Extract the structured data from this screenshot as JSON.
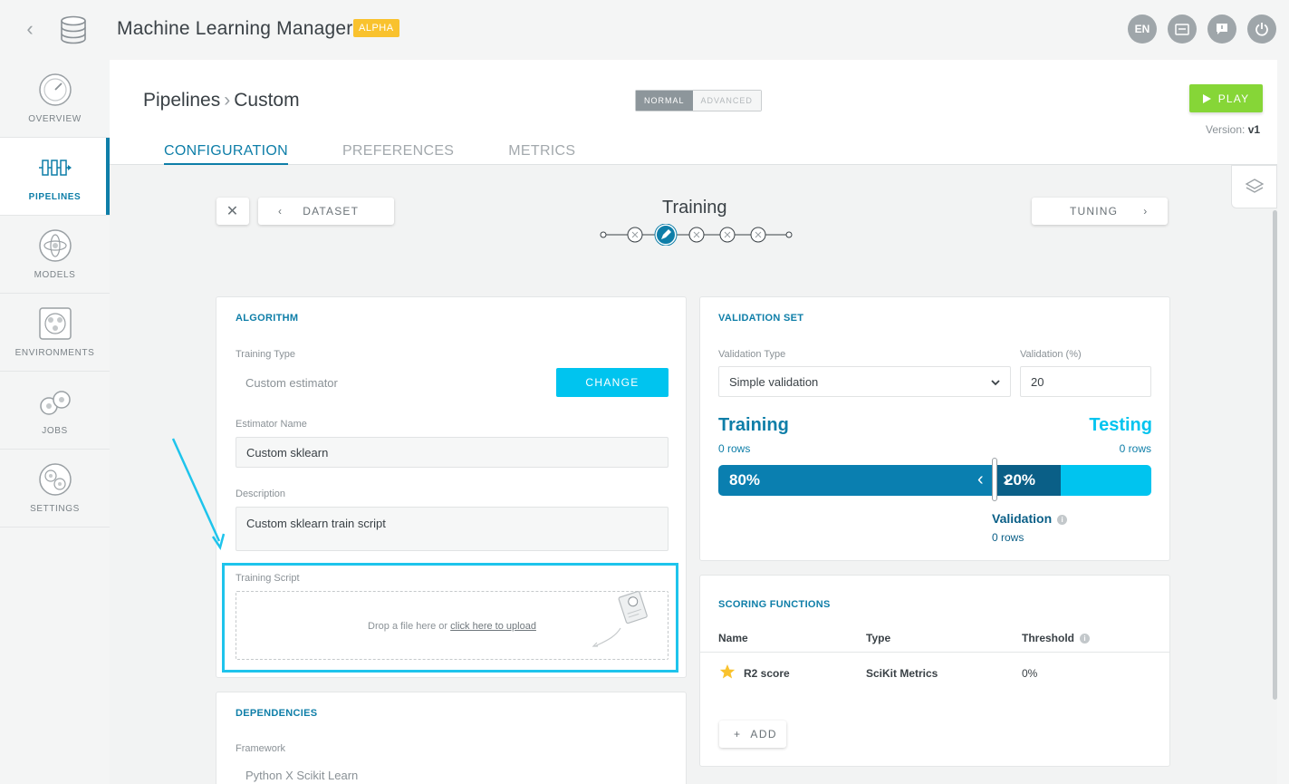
{
  "app": {
    "title": "Machine Learning Manager",
    "badge": "ALPHA",
    "top_icons": {
      "language": "EN"
    }
  },
  "sidebar": {
    "items": [
      {
        "label": "OVERVIEW",
        "icon": "gauge-icon"
      },
      {
        "label": "PIPELINES",
        "icon": "pipeline-icon",
        "active": true
      },
      {
        "label": "MODELS",
        "icon": "model-icon"
      },
      {
        "label": "ENVIRONMENTS",
        "icon": "environment-icon"
      },
      {
        "label": "JOBS",
        "icon": "jobs-icon"
      },
      {
        "label": "SETTINGS",
        "icon": "settings-icon"
      }
    ]
  },
  "header": {
    "breadcrumb": [
      "Pipelines",
      "Custom"
    ],
    "modes": [
      "NORMAL",
      "ADVANCED"
    ],
    "play_label": "PLAY",
    "version_label": "Version:",
    "version_value": "v1",
    "tabs": [
      "CONFIGURATION",
      "PREFERENCES",
      "METRICS"
    ]
  },
  "steps": {
    "prev_label": "DATASET",
    "next_label": "TUNING",
    "current_title": "Training"
  },
  "algorithm": {
    "title": "ALGORITHM",
    "training_type_label": "Training Type",
    "training_type_value": "Custom estimator",
    "change_label": "CHANGE",
    "estimator_name_label": "Estimator Name",
    "estimator_name_value": "Custom sklearn",
    "description_label": "Description",
    "description_value": "Custom sklearn train script",
    "training_script_label": "Training Script",
    "drop_text": "Drop a file here  or",
    "upload_link": "click here to upload"
  },
  "dependencies": {
    "title": "DEPENDENCIES",
    "framework_label": "Framework",
    "framework_value": "Python X Scikit Learn"
  },
  "validation": {
    "title": "VALIDATION SET",
    "type_label": "Validation Type",
    "type_value": "Simple validation",
    "percent_label": "Validation (%)",
    "percent_value": "20",
    "training_heading": "Training",
    "training_rows": "0 rows",
    "testing_heading": "Testing",
    "testing_rows": "0 rows",
    "training_pct_text": "80%",
    "validation_pct_text": "20%",
    "validation_heading": "Validation",
    "validation_rows": "0 rows",
    "split": {
      "training": 0.8,
      "validation": 0.2
    }
  },
  "scoring": {
    "title": "SCORING FUNCTIONS",
    "columns": [
      "Name",
      "Type",
      "Threshold"
    ],
    "rows": [
      {
        "name": "R2 score",
        "type": "SciKit Metrics",
        "threshold": "0%"
      }
    ],
    "add_label": "ADD"
  },
  "colors": {
    "accent": "#0e7ea8",
    "cyan": "#00c4ef",
    "play": "#86d637",
    "badge": "#f9c22e"
  }
}
